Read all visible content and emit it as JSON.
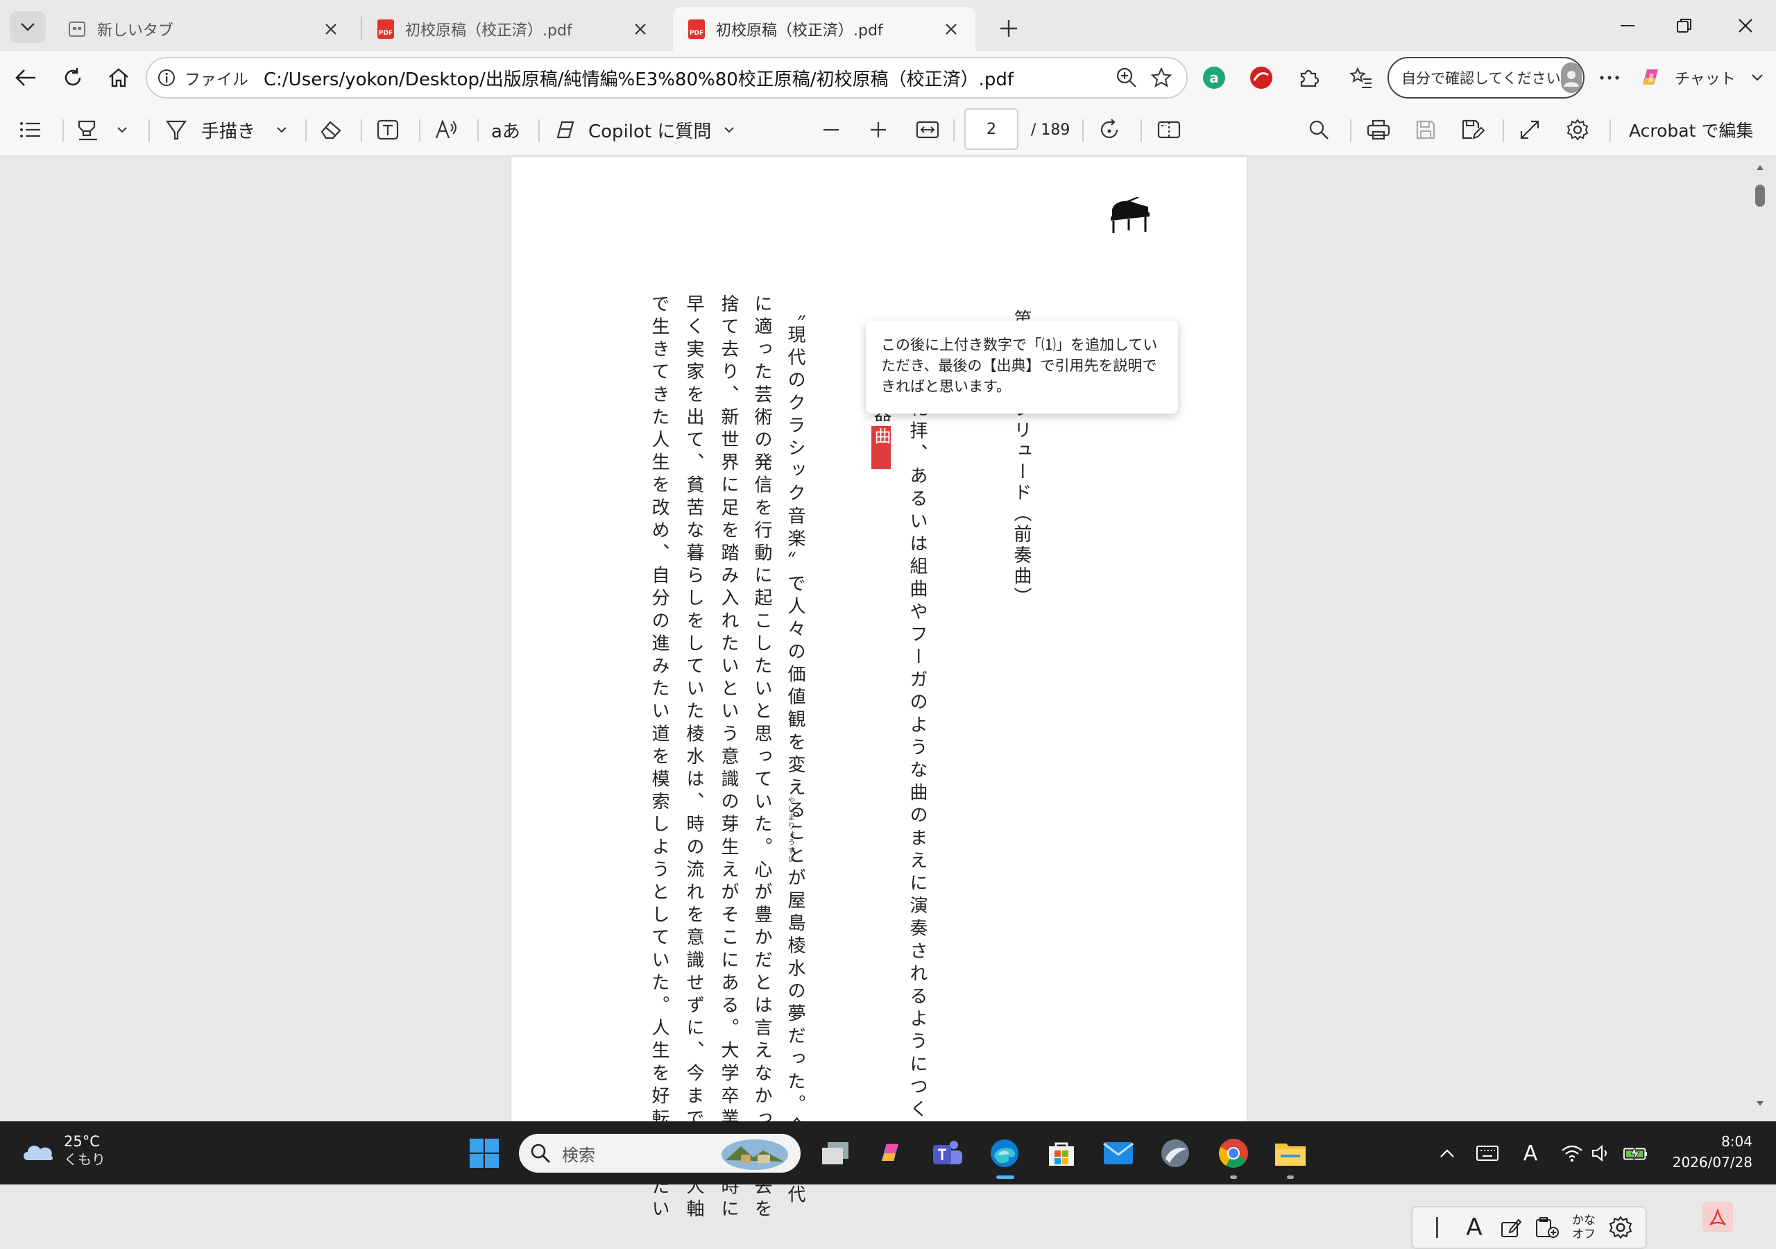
{
  "browser": {
    "tabs": [
      {
        "title": "新しいタブ",
        "active": false
      },
      {
        "title": "初校原稿（校正済）.pdf",
        "active": false
      },
      {
        "title": "初校原稿（校正済）.pdf",
        "active": true
      }
    ],
    "address": {
      "scheme_label": "ファイル",
      "url": "C:/Users/yokon/Desktop/出版原稿/純情編%E3%80%80校正原稿/初校原稿（校正済）.pdf"
    },
    "profile": {
      "label": "自分で確認してください"
    },
    "chat": {
      "label": "チャット"
    }
  },
  "pdf_toolbar": {
    "draw_label": "手描き",
    "read_aloud_glyph": "aあ",
    "copilot_label": "Copilot に質問",
    "current_page": "2",
    "total_pages": "/ 189",
    "acrobat_label": "Acrobat で編集"
  },
  "document": {
    "chapter_heading": "第一",
    "prelude_word": "プレリュード（前奏曲）",
    "columns": [
      "礼拝、あるいは組曲やフーガのような曲のまえに演奏されるようにつくられた",
      "〝現代のクラシック音楽〟で人々の価値観を変えることが屋島棱水の夢だった。今の時代",
      "に適った芸術の発信を行動に起こしたいと思っていた。心が豊かだとは言えなかった過去を",
      "捨て去り、新世界に足を踏み入れたいという意識の芽生えがそこにある。大学卒業と同時に",
      "早く実家を出て、貧苦な暮らしをしていた棱水は、時の流れを意識せずに、今までの他人軸",
      "で生きてきた人生を改め、自分の進みたい道を模索しようとしていた。人生を好転させたい"
    ],
    "ruby": "やしまりょうすい",
    "highlight_char_1": "器",
    "highlight_char_2": "曲",
    "comment": "この後に上付き数字で「⑴」を追加していただき、最後の【出典】で引用先を説明できればと思います。"
  },
  "ime_palette": {
    "kana_label_1": "かな",
    "kana_label_2": "オフ",
    "mode_glyph": "A"
  },
  "taskbar": {
    "weather_temp": "25°C",
    "weather_desc": "くもり",
    "search_placeholder": "検索",
    "ime_indicator": "A",
    "time": "8:04",
    "date": "2026/07/28"
  },
  "colors": {
    "highlight": "#e03c3c",
    "pdf_red": "#e2332f",
    "taskbar": "#1f1f1f",
    "accent_blue": "#0a6ed1"
  }
}
